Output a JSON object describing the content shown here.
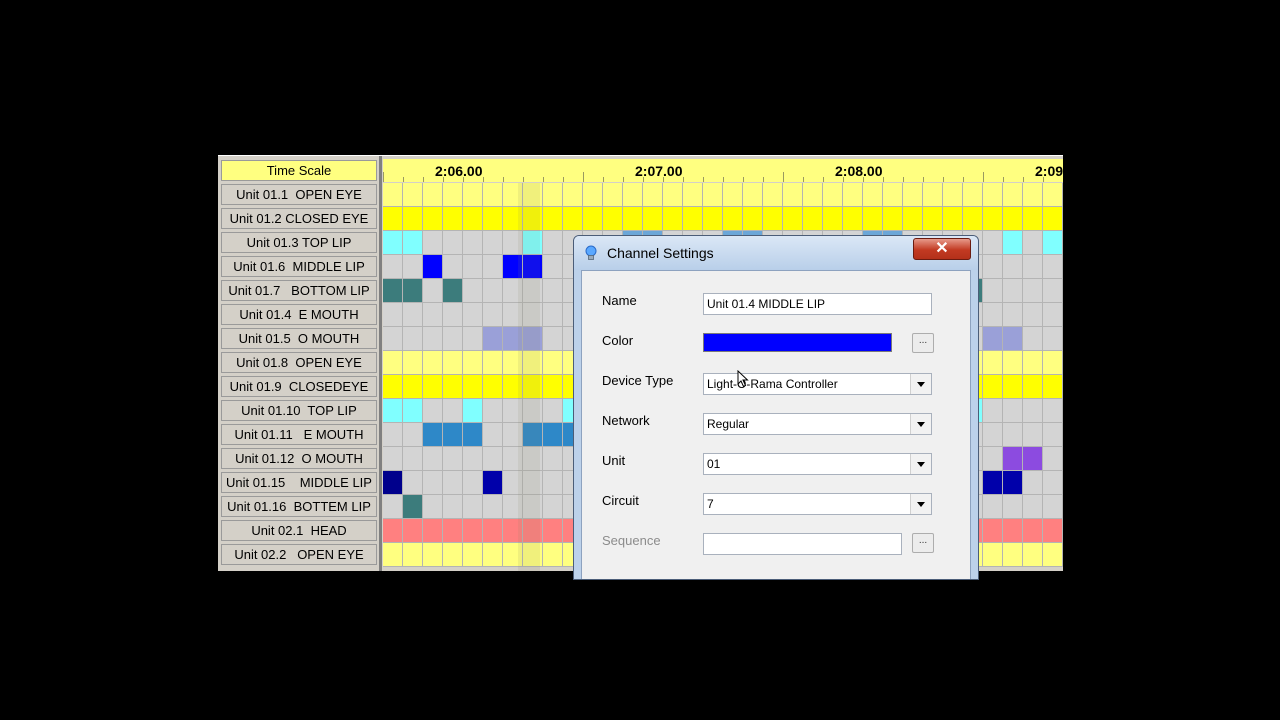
{
  "header": {
    "time_scale_label": "Time Scale"
  },
  "timeline": {
    "markers": [
      "2:06.00",
      "2:07.00",
      "2:08.00",
      "2:09"
    ]
  },
  "channels": [
    {
      "name": "Unit 01.1  OPEN EYE",
      "cells": "yyyyyyyyyyyyyyyyyyyyyyyyyyyyyyyyyy"
    },
    {
      "name": "Unit 01.2 CLOSED EYE",
      "cells": "YYYYYYYYYYYYYYYYYYYYYYYYYYYYYYYYYY"
    },
    {
      "name": "Unit 01.3 TOP LIP",
      "cells": "ccgggggcggggGGgggGGgggggGGgggggcgc"
    },
    {
      "name": "Unit 01.6  MIDDLE LIP",
      "cells": "ggBgggBBgggggggggBBgggBggggBBgggggB"
    },
    {
      "name": "Unit 01.7   BOTTOM LIP",
      "cells": "TTgTgggggggggggggggggggggggggTgggg"
    },
    {
      "name": "Unit 01.4  E MOUTH",
      "cells": "gggggggggggggggggggggggggggggggggg"
    },
    {
      "name": "Unit 01.5  O MOUTH",
      "cells": "gggggpppggggggggggggggggggggggppggg"
    },
    {
      "name": "Unit 01.8  OPEN EYE",
      "cells": "yyyyyyyyyyyyyyyyyyyyyyyyyyyyyyyyyy"
    },
    {
      "name": "Unit 01.9  CLOSEDEYE",
      "cells": "YYYYYYYYYYYYYYYYYYYYYYYYYYYYYYYYYY"
    },
    {
      "name": "Unit 01.10  TOP LIP",
      "cells": "ccggcggggcgggggggggggggggggggcgggg"
    },
    {
      "name": "Unit 01.11   E MOUTH",
      "cells": "ggbbbggbbbgggggggggggggggggggggggg"
    },
    {
      "name": "Unit 01.12  O MOUTH",
      "cells": "gggggggggggggggggggggggggggggggvvg"
    },
    {
      "name": "Unit 01.15    MIDDLE LIP",
      "cells": "Dggggdggggddggggggggggggggggggddgg"
    },
    {
      "name": "Unit 01.16  BOTTEM LIP",
      "cells": "gTgggggggggggggggggggggggggggggggg"
    },
    {
      "name": "Unit 02.1  HEAD",
      "cells": "rrrrrrrrrrrrrrrrrrrrrrrrrrrrrrrrrr"
    },
    {
      "name": "Unit 02.2   OPEN EYE",
      "cells": "yyyyyyyyyyyyyyyyyyyyyyyyyyyyyyyyyy"
    }
  ],
  "cell_colors": {
    "y": "#ffff80",
    "Y": "#ffff00",
    "c": "#80ffff",
    "g": "#d4d4d4",
    "G": "#6ba6d8",
    "B": "#0000ff",
    "T": "#3c7c7c",
    "p": "#9aa0d8",
    "b": "#2e88c8",
    "v": "#8c4be0",
    "D": "#00008c",
    "d": "#0000aa",
    "r": "#ff8080"
  },
  "dialog": {
    "title": "Channel Settings",
    "close_label": "✕",
    "fields": {
      "name_label": "Name",
      "name_value": "Unit 01.4  MIDDLE LIP",
      "color_label": "Color",
      "color_value": "#0000ff",
      "color_button": "...",
      "device_type_label": "Device Type",
      "device_type_value": "Light-O-Rama Controller",
      "network_label": "Network",
      "network_value": "Regular",
      "unit_label": "Unit",
      "unit_value": "01",
      "circuit_label": "Circuit",
      "circuit_value": "7",
      "sequence_label": "Sequence",
      "sequence_value": "",
      "sequence_button": "..."
    }
  },
  "icons": {
    "dialog_icon": "lightbulb-icon",
    "close": "close-icon",
    "cursor": "mouse-cursor-icon"
  }
}
